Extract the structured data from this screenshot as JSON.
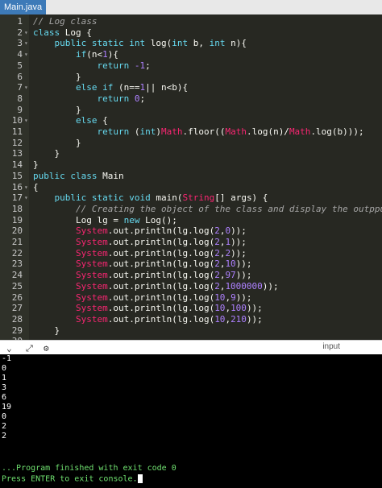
{
  "tab": {
    "label": "Main.java"
  },
  "editor": {
    "lines": [
      {
        "n": "1",
        "fold": "",
        "tokens": [
          {
            "t": "// Log class",
            "c": "com"
          }
        ]
      },
      {
        "n": "2",
        "fold": "▾",
        "tokens": [
          {
            "t": "class ",
            "c": "kw"
          },
          {
            "t": "Log {",
            "c": "plain"
          }
        ]
      },
      {
        "n": "3",
        "fold": "▾",
        "tokens": [
          {
            "t": "    public static int ",
            "c": "kw"
          },
          {
            "t": "log(",
            "c": "plain"
          },
          {
            "t": "int ",
            "c": "kw"
          },
          {
            "t": "b, ",
            "c": "plain"
          },
          {
            "t": "int ",
            "c": "kw"
          },
          {
            "t": "n){",
            "c": "plain"
          }
        ]
      },
      {
        "n": "4",
        "fold": "▾",
        "tokens": [
          {
            "t": "        if",
            "c": "kw"
          },
          {
            "t": "(n<",
            "c": "plain"
          },
          {
            "t": "1",
            "c": "num"
          },
          {
            "t": "){",
            "c": "plain"
          }
        ]
      },
      {
        "n": "5",
        "fold": "",
        "tokens": [
          {
            "t": "            return ",
            "c": "kw"
          },
          {
            "t": "-1",
            "c": "num"
          },
          {
            "t": ";",
            "c": "plain"
          }
        ]
      },
      {
        "n": "6",
        "fold": "",
        "tokens": [
          {
            "t": "        }",
            "c": "plain"
          }
        ]
      },
      {
        "n": "7",
        "fold": "▾",
        "tokens": [
          {
            "t": "        else if ",
            "c": "kw"
          },
          {
            "t": "(n==",
            "c": "plain"
          },
          {
            "t": "1",
            "c": "num"
          },
          {
            "t": "|| n<b){",
            "c": "plain"
          }
        ]
      },
      {
        "n": "8",
        "fold": "",
        "tokens": [
          {
            "t": "            return ",
            "c": "kw"
          },
          {
            "t": "0",
            "c": "num"
          },
          {
            "t": ";",
            "c": "plain"
          }
        ]
      },
      {
        "n": "9",
        "fold": "",
        "tokens": [
          {
            "t": "        }",
            "c": "plain"
          }
        ]
      },
      {
        "n": "10",
        "fold": "▾",
        "tokens": [
          {
            "t": "        else ",
            "c": "kw"
          },
          {
            "t": "{",
            "c": "plain"
          }
        ]
      },
      {
        "n": "11",
        "fold": "",
        "tokens": [
          {
            "t": "            return ",
            "c": "kw"
          },
          {
            "t": "(",
            "c": "plain"
          },
          {
            "t": "int",
            "c": "kw"
          },
          {
            "t": ")",
            "c": "plain"
          },
          {
            "t": "Math",
            "c": "ty"
          },
          {
            "t": ".floor((",
            "c": "plain"
          },
          {
            "t": "Math",
            "c": "ty"
          },
          {
            "t": ".log(n)/",
            "c": "plain"
          },
          {
            "t": "Math",
            "c": "ty"
          },
          {
            "t": ".log(b)));",
            "c": "plain"
          }
        ]
      },
      {
        "n": "12",
        "fold": "",
        "tokens": [
          {
            "t": "        }",
            "c": "plain"
          }
        ]
      },
      {
        "n": "13",
        "fold": "",
        "tokens": [
          {
            "t": "    }",
            "c": "plain"
          }
        ]
      },
      {
        "n": "14",
        "fold": "",
        "tokens": [
          {
            "t": "}",
            "c": "plain"
          }
        ]
      },
      {
        "n": "15",
        "fold": "",
        "tokens": [
          {
            "t": "public class ",
            "c": "kw"
          },
          {
            "t": "Main",
            "c": "plain"
          }
        ]
      },
      {
        "n": "16",
        "fold": "▾",
        "tokens": [
          {
            "t": "{",
            "c": "plain"
          }
        ]
      },
      {
        "n": "17",
        "fold": "▾",
        "tokens": [
          {
            "t": "    public static void ",
            "c": "kw"
          },
          {
            "t": "main(",
            "c": "plain"
          },
          {
            "t": "String",
            "c": "ty"
          },
          {
            "t": "[] args) {",
            "c": "plain"
          }
        ]
      },
      {
        "n": "18",
        "fold": "",
        "tokens": [
          {
            "t": "        // Creating the object of the class and display the outpput",
            "c": "com"
          }
        ]
      },
      {
        "n": "19",
        "fold": "",
        "tokens": [
          {
            "t": "        Log lg = ",
            "c": "plain"
          },
          {
            "t": "new ",
            "c": "kw"
          },
          {
            "t": "Log();",
            "c": "plain"
          }
        ]
      },
      {
        "n": "20",
        "fold": "",
        "tokens": [
          {
            "t": "        ",
            "c": "plain"
          },
          {
            "t": "System",
            "c": "ty"
          },
          {
            "t": ".out.println(lg.log(",
            "c": "plain"
          },
          {
            "t": "2",
            "c": "num"
          },
          {
            "t": ",",
            "c": "plain"
          },
          {
            "t": "0",
            "c": "num"
          },
          {
            "t": "));",
            "c": "plain"
          }
        ]
      },
      {
        "n": "21",
        "fold": "",
        "tokens": [
          {
            "t": "        ",
            "c": "plain"
          },
          {
            "t": "System",
            "c": "ty"
          },
          {
            "t": ".out.println(lg.log(",
            "c": "plain"
          },
          {
            "t": "2",
            "c": "num"
          },
          {
            "t": ",",
            "c": "plain"
          },
          {
            "t": "1",
            "c": "num"
          },
          {
            "t": "));",
            "c": "plain"
          }
        ]
      },
      {
        "n": "22",
        "fold": "",
        "tokens": [
          {
            "t": "        ",
            "c": "plain"
          },
          {
            "t": "System",
            "c": "ty"
          },
          {
            "t": ".out.println(lg.log(",
            "c": "plain"
          },
          {
            "t": "2",
            "c": "num"
          },
          {
            "t": ",",
            "c": "plain"
          },
          {
            "t": "2",
            "c": "num"
          },
          {
            "t": "));",
            "c": "plain"
          }
        ]
      },
      {
        "n": "23",
        "fold": "",
        "tokens": [
          {
            "t": "        ",
            "c": "plain"
          },
          {
            "t": "System",
            "c": "ty"
          },
          {
            "t": ".out.println(lg.log(",
            "c": "plain"
          },
          {
            "t": "2",
            "c": "num"
          },
          {
            "t": ",",
            "c": "plain"
          },
          {
            "t": "10",
            "c": "num"
          },
          {
            "t": "));",
            "c": "plain"
          }
        ]
      },
      {
        "n": "24",
        "fold": "",
        "tokens": [
          {
            "t": "        ",
            "c": "plain"
          },
          {
            "t": "System",
            "c": "ty"
          },
          {
            "t": ".out.println(lg.log(",
            "c": "plain"
          },
          {
            "t": "2",
            "c": "num"
          },
          {
            "t": ",",
            "c": "plain"
          },
          {
            "t": "97",
            "c": "num"
          },
          {
            "t": "));",
            "c": "plain"
          }
        ]
      },
      {
        "n": "25",
        "fold": "",
        "tokens": [
          {
            "t": "        ",
            "c": "plain"
          },
          {
            "t": "System",
            "c": "ty"
          },
          {
            "t": ".out.println(lg.log(",
            "c": "plain"
          },
          {
            "t": "2",
            "c": "num"
          },
          {
            "t": ",",
            "c": "plain"
          },
          {
            "t": "1000000",
            "c": "num"
          },
          {
            "t": "));",
            "c": "plain"
          }
        ]
      },
      {
        "n": "26",
        "fold": "",
        "tokens": [
          {
            "t": "        ",
            "c": "plain"
          },
          {
            "t": "System",
            "c": "ty"
          },
          {
            "t": ".out.println(lg.log(",
            "c": "plain"
          },
          {
            "t": "10",
            "c": "num"
          },
          {
            "t": ",",
            "c": "plain"
          },
          {
            "t": "9",
            "c": "num"
          },
          {
            "t": "));",
            "c": "plain"
          }
        ]
      },
      {
        "n": "27",
        "fold": "",
        "tokens": [
          {
            "t": "        ",
            "c": "plain"
          },
          {
            "t": "System",
            "c": "ty"
          },
          {
            "t": ".out.println(lg.log(",
            "c": "plain"
          },
          {
            "t": "10",
            "c": "num"
          },
          {
            "t": ",",
            "c": "plain"
          },
          {
            "t": "100",
            "c": "num"
          },
          {
            "t": "));",
            "c": "plain"
          }
        ]
      },
      {
        "n": "28",
        "fold": "",
        "tokens": [
          {
            "t": "        ",
            "c": "plain"
          },
          {
            "t": "System",
            "c": "ty"
          },
          {
            "t": ".out.println(lg.log(",
            "c": "plain"
          },
          {
            "t": "10",
            "c": "num"
          },
          {
            "t": ",",
            "c": "plain"
          },
          {
            "t": "210",
            "c": "num"
          },
          {
            "t": "));",
            "c": "plain"
          }
        ]
      },
      {
        "n": "29",
        "fold": "",
        "tokens": [
          {
            "t": "    }",
            "c": "plain"
          }
        ]
      },
      {
        "n": "30",
        "fold": "",
        "tokens": [
          {
            "t": "",
            "c": "plain"
          }
        ]
      }
    ]
  },
  "toolbar": {
    "input_label": "input"
  },
  "console": {
    "output": [
      "-1",
      "0",
      "1",
      "3",
      "6",
      "19",
      "0",
      "2",
      "2"
    ],
    "status": "...Program finished with exit code 0",
    "prompt": "Press ENTER to exit console."
  }
}
